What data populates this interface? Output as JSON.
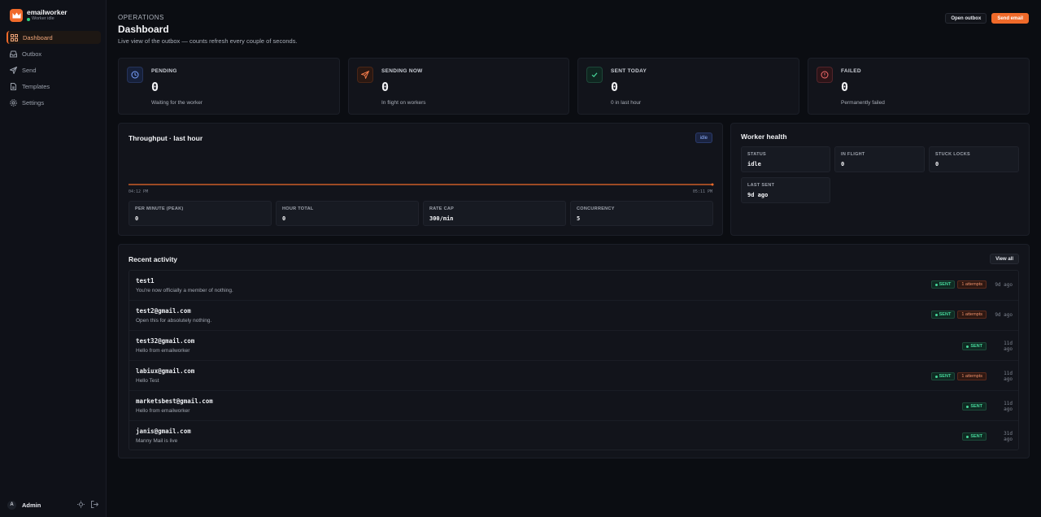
{
  "app": {
    "name": "emailworker",
    "status": "Worker idle",
    "accent": "#f06a2a"
  },
  "sidebar": {
    "items": [
      {
        "label": "Dashboard",
        "icon": "grid-icon",
        "active": true
      },
      {
        "label": "Outbox",
        "icon": "inbox-icon",
        "active": false
      },
      {
        "label": "Send",
        "icon": "send-icon",
        "active": false
      },
      {
        "label": "Templates",
        "icon": "file-icon",
        "active": false
      },
      {
        "label": "Settings",
        "icon": "gear-icon",
        "active": false
      }
    ],
    "user": {
      "initial": "A",
      "name": "Admin"
    }
  },
  "header": {
    "eyebrow": "OPERATIONS",
    "title": "Dashboard",
    "subtitle": "Live view of the outbox — counts refresh every couple of seconds.",
    "open_outbox_label": "Open outbox",
    "send_email_label": "Send email"
  },
  "stats": [
    {
      "label": "PENDING",
      "value": "0",
      "desc": "Waiting for the worker",
      "icon": "clock-icon",
      "color": "#7aa2ff"
    },
    {
      "label": "SENDING NOW",
      "value": "0",
      "desc": "In flight on workers",
      "icon": "send-icon",
      "color": "#f07a4a"
    },
    {
      "label": "SENT TODAY",
      "value": "0",
      "desc": "0 in last hour",
      "icon": "check-icon",
      "color": "#46d69a"
    },
    {
      "label": "FAILED",
      "value": "0",
      "desc": "Permanently failed",
      "icon": "alert-circle-icon",
      "color": "#f06a6a"
    }
  ],
  "throughput": {
    "title": "Throughput · last hour",
    "badge": "idle",
    "start_label": "04:12 PM",
    "end_label": "05:11 PM",
    "metrics": [
      {
        "label": "PER MINUTE (PEAK)",
        "value": "0"
      },
      {
        "label": "HOUR TOTAL",
        "value": "0"
      },
      {
        "label": "RATE CAP",
        "value": "300/min"
      },
      {
        "label": "CONCURRENCY",
        "value": "5"
      }
    ]
  },
  "health": {
    "title": "Worker health",
    "tiles": [
      {
        "label": "STATUS",
        "value": "idle"
      },
      {
        "label": "IN FLIGHT",
        "value": "0"
      },
      {
        "label": "STUCK LOCKS",
        "value": "0"
      },
      {
        "label": "LAST SENT",
        "value": "9d ago"
      }
    ]
  },
  "activity": {
    "title": "Recent activity",
    "view_all_label": "View all",
    "rows": [
      {
        "to": "test1",
        "subject": "You're now officially a member of nothing.",
        "status": "SENT",
        "attempts": "1 attempts",
        "time": "9d ago"
      },
      {
        "to": "test2@gmail.com",
        "subject": "Open this for absolutely nothing.",
        "status": "SENT",
        "attempts": "1 attempts",
        "time": "9d ago"
      },
      {
        "to": "test32@gmail.com",
        "subject": "Hello from emailworker",
        "status": "SENT",
        "attempts": "",
        "time": "11d ago"
      },
      {
        "to": "labiux@gmail.com",
        "subject": "Hello Test",
        "status": "SENT",
        "attempts": "1 attempts",
        "time": "11d ago"
      },
      {
        "to": "marketsbest@gmail.com",
        "subject": "Hello from emailworker",
        "status": "SENT",
        "attempts": "",
        "time": "11d ago"
      },
      {
        "to": "janis@gmail.com",
        "subject": "Manny Mail is live",
        "status": "SENT",
        "attempts": "",
        "time": "31d ago"
      }
    ]
  }
}
